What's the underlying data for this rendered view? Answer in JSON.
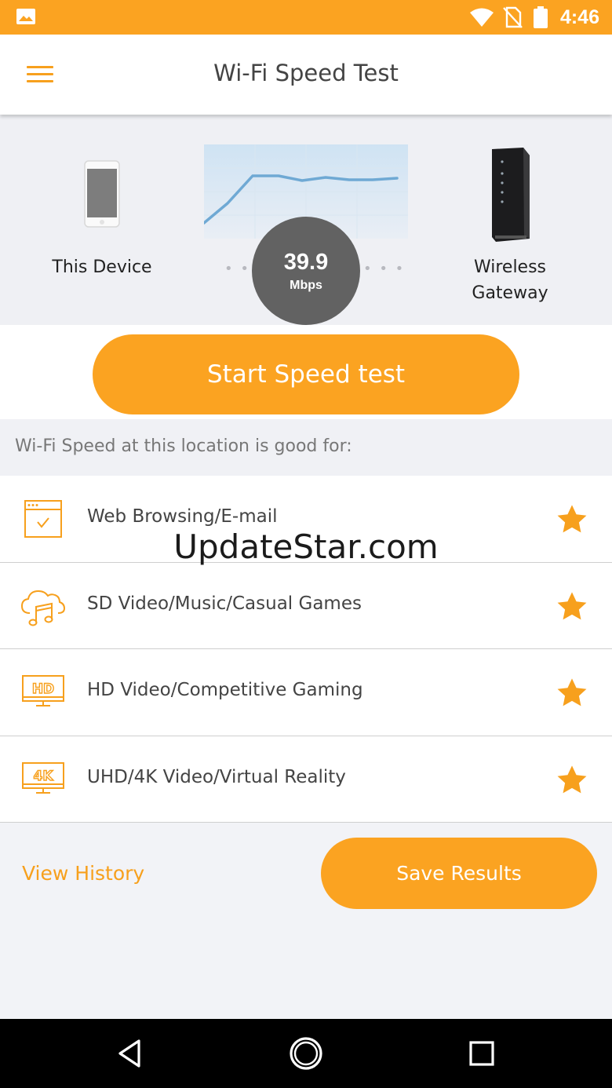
{
  "status_bar": {
    "time": "4:46"
  },
  "app_bar": {
    "title": "Wi-Fi Speed Test"
  },
  "hero": {
    "left_device_label": "This Device",
    "right_device_label_line1": "Wireless",
    "right_device_label_line2": "Gateway",
    "speed_value": "39.9",
    "speed_unit": "Mbps"
  },
  "start_button": {
    "label": "Start Speed test"
  },
  "section_header": "Wi-Fi Speed at this location is good for:",
  "capabilities": [
    {
      "label": "Web Browsing/E-mail",
      "icon": "browser-check-icon",
      "rated": true
    },
    {
      "label": "SD Video/Music/Casual Games",
      "icon": "cloud-music-icon",
      "rated": true
    },
    {
      "label": "HD Video/Competitive Gaming",
      "icon": "hd-monitor-icon",
      "rated": true
    },
    {
      "label": "UHD/4K Video/Virtual Reality",
      "icon": "4k-monitor-icon",
      "rated": true
    }
  ],
  "watermark": "UpdateStar.com",
  "footer": {
    "view_history": "View History",
    "save_results": "Save Results"
  },
  "colors": {
    "accent": "#fba321",
    "circle": "#626262",
    "star": "#f7a01d"
  }
}
